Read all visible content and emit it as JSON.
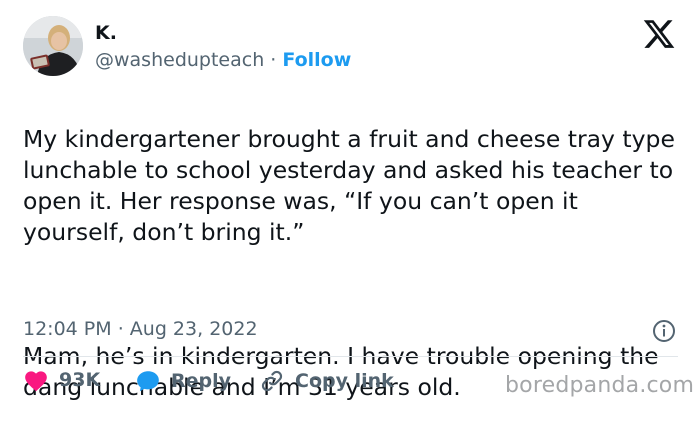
{
  "author": {
    "name": "K.",
    "handle": "@washedupteach",
    "separator": "·",
    "follow_label": "Follow"
  },
  "tweet": {
    "paragraph1": "My kindergartener brought a fruit and cheese tray type lunchable to school yesterday and asked his teacher to open it. Her response was, “If you can’t open it yourself, don’t bring it.”",
    "paragraph2": "Mam, he’s in kindergarten. I have trouble opening the dang lunchable and I’m 31 years old.",
    "time": "12:04 PM",
    "date_separator": "·",
    "date": "Aug 23, 2022"
  },
  "actions": {
    "likes": "93K",
    "reply_label": "Reply",
    "copy_link_label": "Copy link"
  },
  "watermark": "boredpanda.com",
  "icons": {
    "x": "x-logo-icon",
    "info": "info-icon",
    "like": "heart-icon",
    "reply": "speech-bubble-icon",
    "link": "link-icon"
  },
  "colors": {
    "follow": "#1d9bf0",
    "heart": "#f91880",
    "reply_bubble": "#1d9bf0",
    "muted": "#536471",
    "text": "#0f1419"
  }
}
